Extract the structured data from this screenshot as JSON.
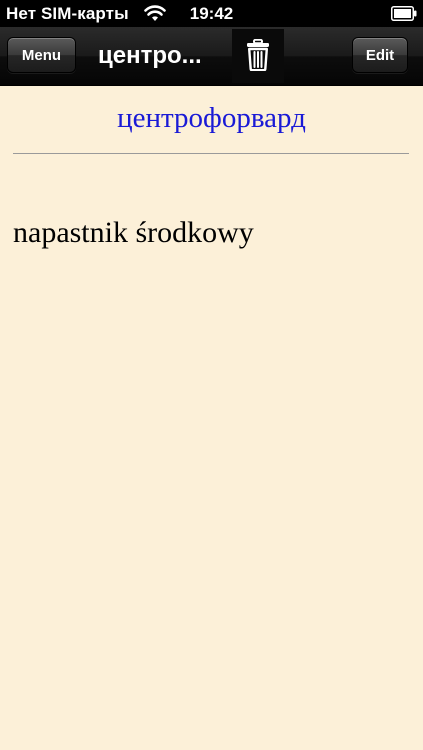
{
  "status_bar": {
    "carrier": "Нет SIM-карты",
    "time": "19:42",
    "wifi_icon": "wifi-icon",
    "battery_icon": "battery-icon"
  },
  "nav_bar": {
    "menu_label": "Menu",
    "title": "центро...",
    "trash_icon": "trash-icon",
    "edit_label": "Edit"
  },
  "entry": {
    "headword": "центрофорвард",
    "translation": "napastnik środkowy"
  },
  "colors": {
    "background": "#fcf0d8",
    "headword": "#1a1ad6",
    "translation": "#000000",
    "nav_bar": "#1a1a1a"
  }
}
